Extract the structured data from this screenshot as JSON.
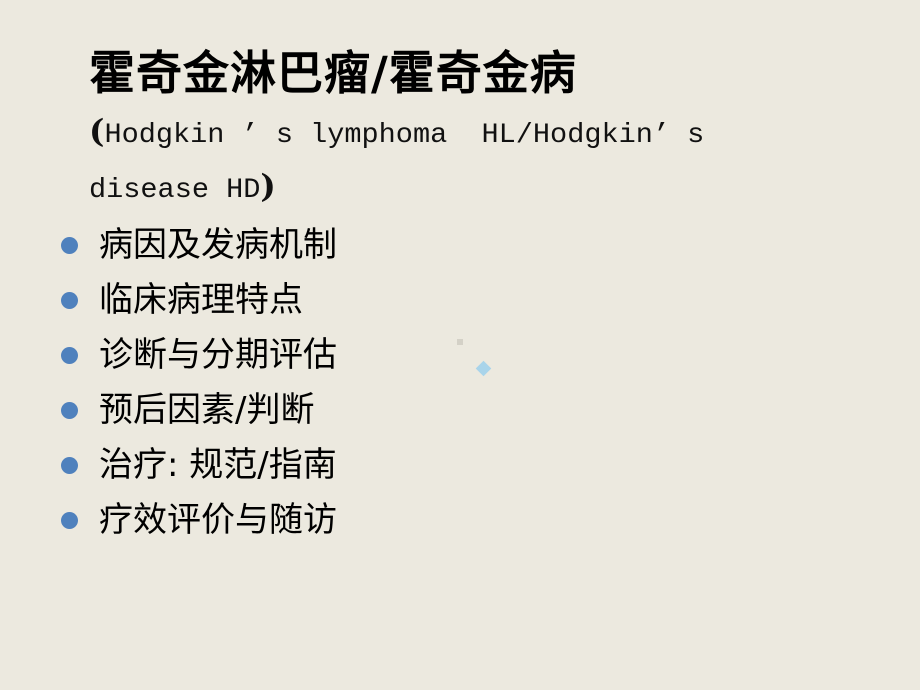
{
  "slide": {
    "title": "霍奇金淋巴瘤/霍奇金病",
    "subtitle": {
      "open_paren": "(",
      "line1": "Hodgkin ’ s lymphoma  HL/Hodgkin’ s",
      "line2": "disease HD",
      "close_paren": ")"
    },
    "bullets": [
      {
        "icon": "bullet-dot",
        "label": "病因及发病机制"
      },
      {
        "icon": "bullet-dot",
        "label": "临床病理特点"
      },
      {
        "icon": "bullet-dot",
        "label": "诊断与分期评估"
      },
      {
        "icon": "bullet-dot",
        "label": "预后因素/判断"
      },
      {
        "icon": "bullet-dot",
        "label": "治疗: 规范/指南"
      },
      {
        "icon": "bullet-dot",
        "label": "疗效评价与随访"
      }
    ],
    "colors": {
      "background": "#ECE9DF",
      "bullet": "#4F81BD",
      "text": "#000000",
      "decor_diamond": "#A9D4EA",
      "decor_square": "#D4D1C7"
    }
  }
}
